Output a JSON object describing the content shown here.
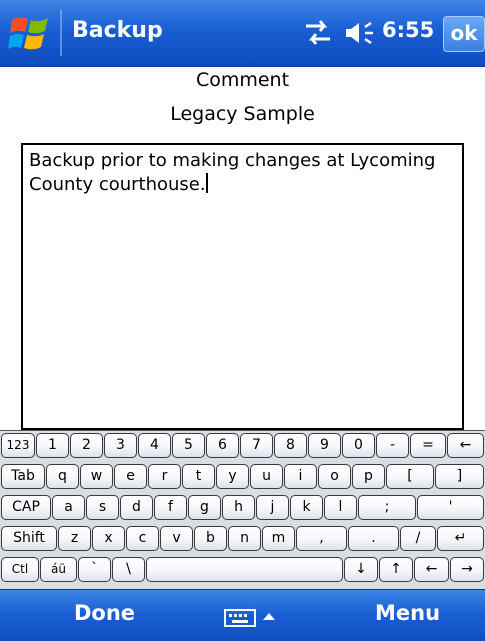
{
  "titlebar": {
    "title": "Backup",
    "time": "6:55",
    "ok_label": "ok",
    "icons": [
      "windows-flag-icon",
      "connectivity-icon",
      "volume-icon"
    ]
  },
  "content": {
    "heading": "Comment",
    "subheading": "Legacy Sample",
    "comment_text": "Backup prior to making changes at Lycoming County courthouse."
  },
  "keyboard": {
    "rows": [
      [
        "123",
        "1",
        "2",
        "3",
        "4",
        "5",
        "6",
        "7",
        "8",
        "9",
        "0",
        "-",
        "=",
        "←"
      ],
      [
        "Tab",
        "q",
        "w",
        "e",
        "r",
        "t",
        "y",
        "u",
        "i",
        "o",
        "p",
        "[",
        "]"
      ],
      [
        "CAP",
        "a",
        "s",
        "d",
        "f",
        "g",
        "h",
        "j",
        "k",
        "l",
        ";",
        "'"
      ],
      [
        "Shift",
        "z",
        "x",
        "c",
        "v",
        "b",
        "n",
        "m",
        ",",
        ".",
        "/",
        "↵"
      ],
      [
        "Ctl",
        "áü",
        "`",
        "\\",
        "",
        "↓",
        "↑",
        "←",
        "→"
      ]
    ]
  },
  "menubar": {
    "left_label": "Done",
    "right_label": "Menu",
    "sip_icon": "keyboard-icon"
  },
  "colors": {
    "bar_blue": "#1a5ed3",
    "keyboard_bg": "#d9dde4"
  }
}
